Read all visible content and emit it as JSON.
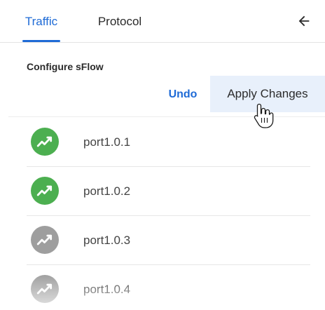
{
  "tabs": [
    {
      "label": "Traffic",
      "active": true
    },
    {
      "label": "Protocol",
      "active": false
    }
  ],
  "header": {
    "back_icon": "arrow-left-icon"
  },
  "panel": {
    "title": "Configure sFlow",
    "undo_label": "Undo",
    "apply_label": "Apply Changes"
  },
  "ports": [
    {
      "label": "port1.0.1",
      "status": "enabled",
      "color": "#4caf50"
    },
    {
      "label": "port1.0.2",
      "status": "enabled",
      "color": "#4caf50"
    },
    {
      "label": "port1.0.3",
      "status": "disabled",
      "color": "#9e9e9e"
    },
    {
      "label": "port1.0.4",
      "status": "disabled",
      "color": "#9e9e9e"
    }
  ],
  "colors": {
    "accent": "#1f6bd6",
    "apply_bg": "#e8f0fb",
    "enabled": "#4caf50",
    "disabled": "#9e9e9e"
  }
}
